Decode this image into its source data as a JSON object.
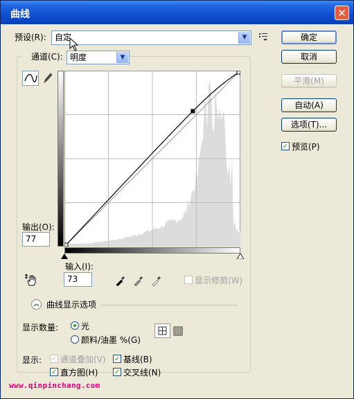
{
  "window": {
    "title": "曲线",
    "close_glyph": "✕"
  },
  "preset": {
    "label": "预设(R):",
    "value": "自定"
  },
  "channel": {
    "label": "通道(C):",
    "value": "明度"
  },
  "buttons": {
    "ok": "确定",
    "cancel": "取消",
    "smooth": "平滑(M)",
    "auto": "自动(A)",
    "options": "选项(T)..."
  },
  "preview": {
    "label": "预览(P)",
    "checked": true
  },
  "output": {
    "label": "输出(O):",
    "value": "77"
  },
  "input": {
    "label": "输入(I):",
    "value": "73"
  },
  "show_clipping": {
    "label": "显示修剪(W)",
    "checked": false
  },
  "curve_display_options": {
    "label": "曲线显示选项"
  },
  "show_amount": {
    "label": "显示数量:",
    "light": "光",
    "pigment": "颜料/油墨 %(G)",
    "selected": "光"
  },
  "show": {
    "label": "显示:",
    "channel_overlay": "通道叠加(V)",
    "baseline": "基线(B)",
    "histogram": "直方图(H)",
    "intersection": "交叉线(N)"
  },
  "watermark": "www.qinpinchang.com",
  "curve": {
    "points": [
      [
        0,
        0
      ],
      [
        73,
        77
      ],
      [
        100,
        100
      ]
    ]
  },
  "colors": {
    "accent": "#21a121",
    "titlebar": "#0b46c4",
    "close": "#e55b3c"
  }
}
